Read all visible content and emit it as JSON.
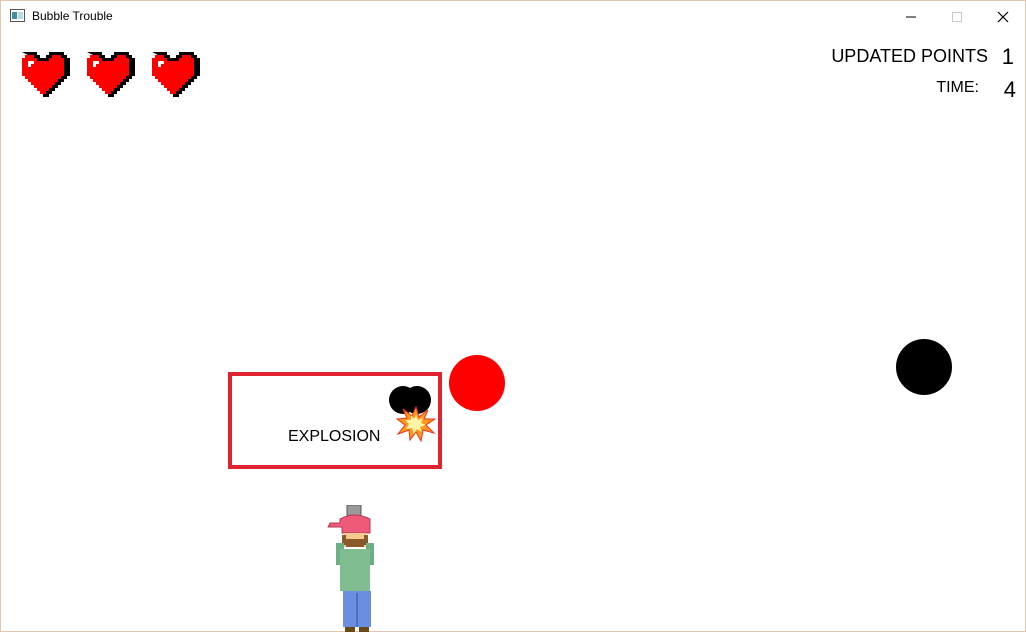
{
  "window": {
    "title": "Bubble Trouble"
  },
  "hud": {
    "lives": 3,
    "points_label": "UPDATED POINTS",
    "points_value": "1",
    "time_label": "TIME:",
    "time_value": "4"
  },
  "explosion": {
    "label": "EXPLOSION"
  },
  "colors": {
    "heart": "#ff0000",
    "red_ball": "#ff0000",
    "black_ball": "#000000",
    "explosion_border": "#e0242f"
  }
}
